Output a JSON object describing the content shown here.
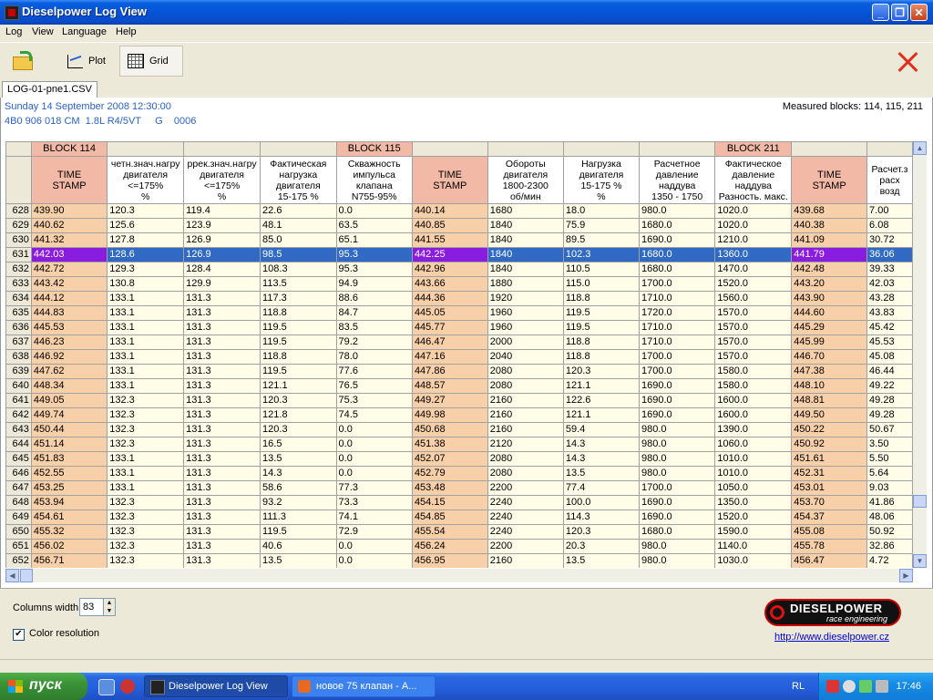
{
  "window": {
    "title": "Dieselpower Log View"
  },
  "menu": [
    "Log",
    "View",
    "Language",
    "Help"
  ],
  "toolbar": {
    "plot_label": "Plot",
    "grid_label": "Grid"
  },
  "tab": {
    "label": "LOG-01-pne1.CSV"
  },
  "info": {
    "date": "Sunday 14 September 2008 12:30:00",
    "engine": "4B0 906 018 CM  1.8L R4/5VT     G    0006",
    "measured_blocks": "Measured blocks: 114, 115, 211"
  },
  "grid": {
    "blocks": {
      "b114": "BLOCK 114",
      "b115": "BLOCK 115",
      "b211": "BLOCK 211"
    },
    "headers": [
      "TIME\nSTAMP",
      "четн.знач.нагру\nдвигателя\n<=175%\n%",
      "ррек.знач.нагру\nдвигателя\n<=175%\n%",
      "Фактическая\nнагрузка\nдвигателя\n15-175 %",
      "Скважность\nимпульса\nклапана\nN755-95%",
      "TIME\nSTAMP",
      "Обороты\nдвигателя\n1800-2300\nоб/мин",
      "Нагрузка\nдвигателя\n15-175 %\n%",
      "Расчетное\nдавление\nнаддува\n1350 - 1750",
      "Фактическое\nдавление\nнаддува\nРазность. макс.",
      "TIME\nSTAMP",
      "Расчет.з\nрасх\nвозд"
    ],
    "selected_row": "631",
    "rows": [
      [
        "628",
        "439.90",
        "120.3",
        "119.4",
        "22.6",
        "0.0",
        "440.14",
        "1680",
        "18.0",
        "980.0",
        "1020.0",
        "439.68",
        "7.00"
      ],
      [
        "629",
        "440.62",
        "125.6",
        "123.9",
        "48.1",
        "63.5",
        "440.85",
        "1840",
        "75.9",
        "1680.0",
        "1020.0",
        "440.38",
        "6.08"
      ],
      [
        "630",
        "441.32",
        "127.8",
        "126.9",
        "85.0",
        "65.1",
        "441.55",
        "1840",
        "89.5",
        "1690.0",
        "1210.0",
        "441.09",
        "30.72"
      ],
      [
        "631",
        "442.03",
        "128.6",
        "126.9",
        "98.5",
        "95.3",
        "442.25",
        "1840",
        "102.3",
        "1680.0",
        "1360.0",
        "441.79",
        "36.06"
      ],
      [
        "632",
        "442.72",
        "129.3",
        "128.4",
        "108.3",
        "95.3",
        "442.96",
        "1840",
        "110.5",
        "1680.0",
        "1470.0",
        "442.48",
        "39.33"
      ],
      [
        "633",
        "443.42",
        "130.8",
        "129.9",
        "113.5",
        "94.9",
        "443.66",
        "1880",
        "115.0",
        "1700.0",
        "1520.0",
        "443.20",
        "42.03"
      ],
      [
        "634",
        "444.12",
        "133.1",
        "131.3",
        "117.3",
        "88.6",
        "444.36",
        "1920",
        "118.8",
        "1710.0",
        "1560.0",
        "443.90",
        "43.28"
      ],
      [
        "635",
        "444.83",
        "133.1",
        "131.3",
        "118.8",
        "84.7",
        "445.05",
        "1960",
        "119.5",
        "1720.0",
        "1570.0",
        "444.60",
        "43.83"
      ],
      [
        "636",
        "445.53",
        "133.1",
        "131.3",
        "119.5",
        "83.5",
        "445.77",
        "1960",
        "119.5",
        "1710.0",
        "1570.0",
        "445.29",
        "45.42"
      ],
      [
        "637",
        "446.23",
        "133.1",
        "131.3",
        "119.5",
        "79.2",
        "446.47",
        "2000",
        "118.8",
        "1710.0",
        "1570.0",
        "445.99",
        "45.53"
      ],
      [
        "638",
        "446.92",
        "133.1",
        "131.3",
        "118.8",
        "78.0",
        "447.16",
        "2040",
        "118.8",
        "1700.0",
        "1570.0",
        "446.70",
        "45.08"
      ],
      [
        "639",
        "447.62",
        "133.1",
        "131.3",
        "119.5",
        "77.6",
        "447.86",
        "2080",
        "120.3",
        "1700.0",
        "1580.0",
        "447.38",
        "46.44"
      ],
      [
        "640",
        "448.34",
        "133.1",
        "131.3",
        "121.1",
        "76.5",
        "448.57",
        "2080",
        "121.1",
        "1690.0",
        "1580.0",
        "448.10",
        "49.22"
      ],
      [
        "641",
        "449.05",
        "132.3",
        "131.3",
        "120.3",
        "75.3",
        "449.27",
        "2160",
        "122.6",
        "1690.0",
        "1600.0",
        "448.81",
        "49.28"
      ],
      [
        "642",
        "449.74",
        "132.3",
        "131.3",
        "121.8",
        "74.5",
        "449.98",
        "2160",
        "121.1",
        "1690.0",
        "1600.0",
        "449.50",
        "49.28"
      ],
      [
        "643",
        "450.44",
        "132.3",
        "131.3",
        "120.3",
        "0.0",
        "450.68",
        "2160",
        "59.4",
        "980.0",
        "1390.0",
        "450.22",
        "50.67"
      ],
      [
        "644",
        "451.14",
        "132.3",
        "131.3",
        "16.5",
        "0.0",
        "451.38",
        "2120",
        "14.3",
        "980.0",
        "1060.0",
        "450.92",
        "3.50"
      ],
      [
        "645",
        "451.83",
        "133.1",
        "131.3",
        "13.5",
        "0.0",
        "452.07",
        "2080",
        "14.3",
        "980.0",
        "1010.0",
        "451.61",
        "5.50"
      ],
      [
        "646",
        "452.55",
        "133.1",
        "131.3",
        "14.3",
        "0.0",
        "452.79",
        "2080",
        "13.5",
        "980.0",
        "1010.0",
        "452.31",
        "5.64"
      ],
      [
        "647",
        "453.25",
        "133.1",
        "131.3",
        "58.6",
        "77.3",
        "453.48",
        "2200",
        "77.4",
        "1700.0",
        "1050.0",
        "453.01",
        "9.03"
      ],
      [
        "648",
        "453.94",
        "132.3",
        "131.3",
        "93.2",
        "73.3",
        "454.15",
        "2240",
        "100.0",
        "1690.0",
        "1350.0",
        "453.70",
        "41.86"
      ],
      [
        "649",
        "454.61",
        "132.3",
        "131.3",
        "111.3",
        "74.1",
        "454.85",
        "2240",
        "114.3",
        "1690.0",
        "1520.0",
        "454.37",
        "48.06"
      ],
      [
        "650",
        "455.32",
        "132.3",
        "131.3",
        "119.5",
        "72.9",
        "455.54",
        "2240",
        "120.3",
        "1680.0",
        "1590.0",
        "455.08",
        "50.92"
      ],
      [
        "651",
        "456.02",
        "132.3",
        "131.3",
        "40.6",
        "0.0",
        "456.24",
        "2200",
        "20.3",
        "980.0",
        "1140.0",
        "455.78",
        "32.86"
      ],
      [
        "652",
        "456.71",
        "132.3",
        "131.3",
        "13.5",
        "0.0",
        "456.95",
        "2160",
        "13.5",
        "980.0",
        "1030.0",
        "456.47",
        "4.72"
      ]
    ]
  },
  "bottom": {
    "columns_width_label": "Columns width:",
    "columns_width_value": "83",
    "color_resolution_label": "Color resolution",
    "color_resolution_checked": "✔",
    "logo_line1": "DIESELPOWER",
    "logo_line2": "race engineering",
    "link": "http://www.dieselpower.cz"
  },
  "taskbar": {
    "start": "пуск",
    "task1": "Dieselpower Log View",
    "task2": "новое 75 клапан - A...",
    "lang": "RL",
    "clock": "17:46"
  }
}
